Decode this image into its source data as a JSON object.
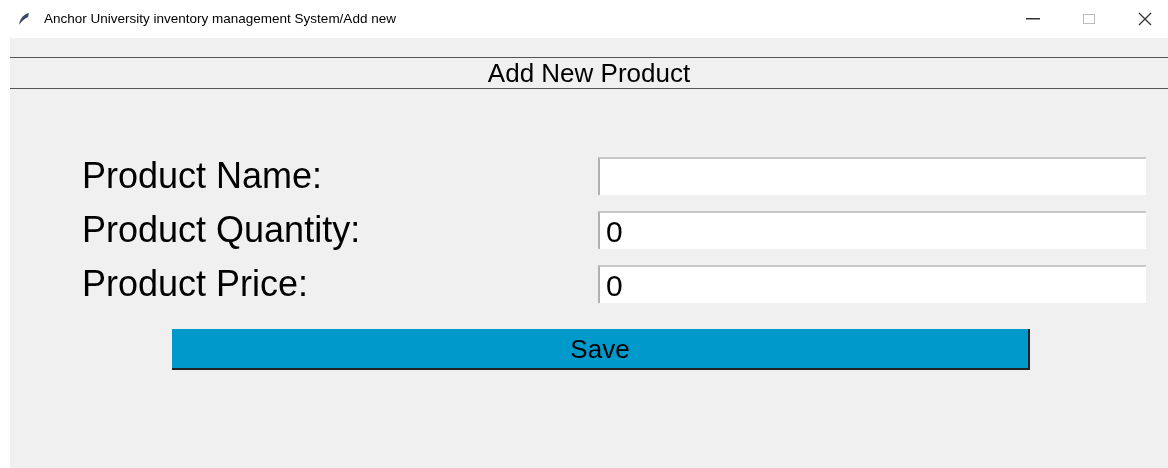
{
  "window": {
    "title": "Anchor University inventory  management System/Add new"
  },
  "header": "Add New Product",
  "fields": [
    {
      "label": "Product Name:"
    },
    {
      "label": "Product Quantity:",
      "value": "0"
    },
    {
      "label": "Product Price:",
      "value": "0"
    }
  ],
  "buttons": [
    "Save"
  ]
}
